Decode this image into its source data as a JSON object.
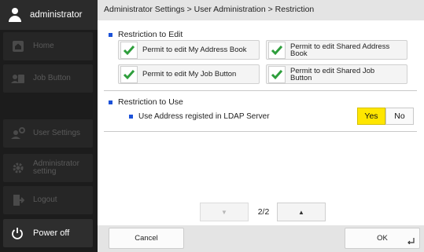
{
  "user": {
    "name": "administrator",
    "icon": "user-icon"
  },
  "sidebar": {
    "items": [
      {
        "label": "Home",
        "icon": "home-icon"
      },
      {
        "label": "Job Button",
        "icon": "job-button-icon"
      },
      {
        "label": "User Settings",
        "icon": "user-settings-icon"
      },
      {
        "label_line1": "Administrator",
        "label_line2": "setting",
        "icon": "gear-icon"
      },
      {
        "label": "Logout",
        "icon": "logout-icon"
      }
    ],
    "power": {
      "label": "Power off",
      "icon": "power-icon"
    }
  },
  "breadcrumb": "Administrator Settings > User Administration > Restriction",
  "restriction_to_edit": {
    "title": "Restriction to Edit",
    "options": [
      {
        "label_line1": "Permit to edit My Address Book",
        "label_line2": "",
        "checked": true
      },
      {
        "label_line1": "Permit to edit Shared Address",
        "label_line2": "Book",
        "checked": true
      },
      {
        "label_line1": "Permit to edit My Job Button",
        "label_line2": "",
        "checked": true
      },
      {
        "label_line1": "Permit to edit Shared Job",
        "label_line2": "Button",
        "checked": true
      }
    ]
  },
  "restriction_to_use": {
    "title": "Restriction to Use",
    "item": {
      "label": "Use Address registed in LDAP Server",
      "selected": "Yes"
    },
    "yes_label": "Yes",
    "no_label": "No"
  },
  "pager": {
    "current": "2/2",
    "down_icon": "triangle-down-icon",
    "up_icon": "triangle-up-icon"
  },
  "footer": {
    "cancel_label": "Cancel",
    "ok_label": "OK",
    "ok_icon": "enter-icon"
  },
  "colors": {
    "accent": "#1c52d8",
    "check": "#2e9e3c",
    "selected": "#ffe600",
    "sidebar_bg": "#1c1c1c"
  }
}
